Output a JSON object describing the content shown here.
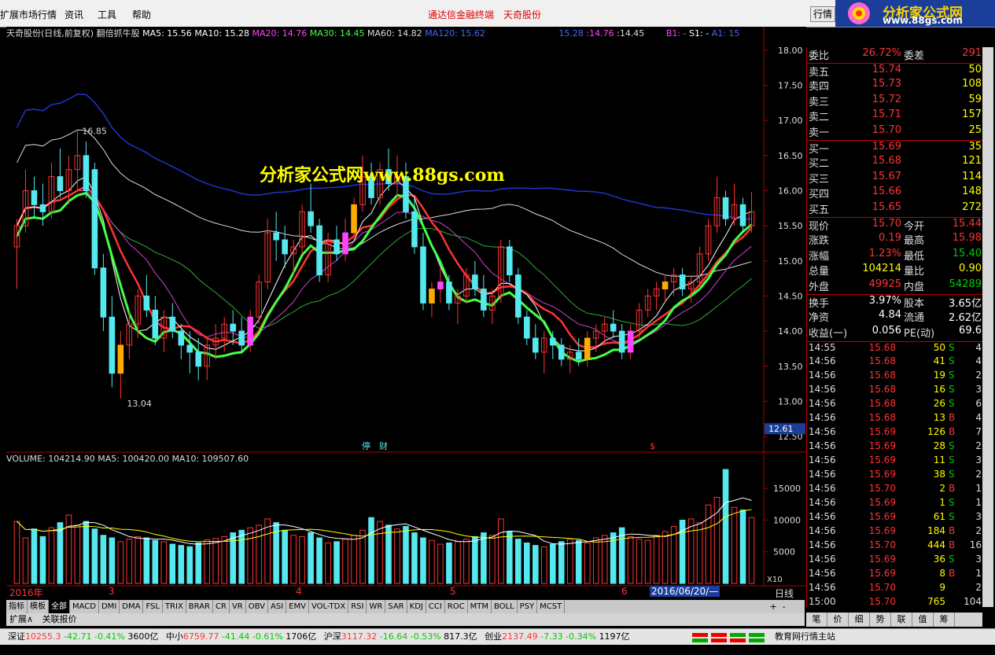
{
  "menu": {
    "title": "扩展市场行情",
    "items": [
      "资讯",
      "工具",
      "帮助"
    ],
    "center_a": "通达信金融终端",
    "center_b": "天奇股份",
    "row_btn": "行情"
  },
  "logo": {
    "title": "分析家公式网",
    "url": "www.88gs.com"
  },
  "chart_header": {
    "name": "天奇股份(日线,前复权)",
    "formula": "翻倍抓牛股",
    "ma5": "MA5: 15.56",
    "ma10": "MA10: 15.28",
    "ma20": "MA20: 14.76",
    "ma30": "MA30: 14.45",
    "ma60": "MA60: 14.82",
    "ma120": "MA120: 15.62",
    "extra1": "15.28",
    "extra2": ":14.76",
    "extra3": ":14.45",
    "b1": "B1: -",
    "s1": "S1: -",
    "a1": "A1: 15"
  },
  "watermark": "分析家公式网www.88gs.com",
  "chart_data": {
    "type": "candlestick",
    "ylim": [
      12.4,
      18.2
    ],
    "yticks": [
      "18.00",
      "17.50",
      "17.00",
      "16.50",
      "16.00",
      "15.50",
      "15.00",
      "14.50",
      "14.00",
      "13.50",
      "13.00",
      "12.50"
    ],
    "current_price_label": "12.61",
    "high_label": "16.85",
    "low_label": "13.04",
    "event_labels": [
      "停",
      "财",
      "$"
    ],
    "volume_header": "VOLUME: 104214.90  MA5: 100420.00  MA10: 109507.60",
    "volume_ticks": [
      "15000",
      "10000",
      "5000"
    ],
    "volume_unit": "X10",
    "date_labels": [
      "2016年",
      "3",
      "4",
      "5",
      "6"
    ],
    "cursor_date": "2016/06/20/—",
    "ohlc": [
      [
        15.2,
        15.6,
        14.6,
        15.5
      ],
      [
        15.5,
        16.3,
        15.4,
        16.0
      ],
      [
        16.0,
        16.2,
        15.6,
        15.8
      ],
      [
        15.8,
        16.1,
        15.5,
        15.7
      ],
      [
        15.7,
        16.4,
        15.6,
        16.2
      ],
      [
        16.2,
        16.6,
        15.9,
        16.0
      ],
      [
        16.0,
        16.5,
        15.8,
        16.3
      ],
      [
        16.3,
        16.85,
        16.0,
        16.5
      ],
      [
        16.5,
        16.7,
        15.9,
        16.0
      ],
      [
        16.3,
        16.4,
        14.8,
        14.9
      ],
      [
        14.9,
        15.1,
        14.0,
        14.2
      ],
      [
        14.2,
        14.5,
        13.2,
        13.4
      ],
      [
        13.4,
        14.0,
        13.04,
        13.8
      ],
      [
        13.8,
        14.3,
        13.6,
        14.1
      ],
      [
        14.1,
        14.6,
        13.9,
        14.5
      ],
      [
        14.5,
        14.8,
        14.2,
        14.3
      ],
      [
        14.3,
        14.5,
        13.8,
        13.9
      ],
      [
        13.9,
        14.3,
        13.7,
        14.2
      ],
      [
        14.2,
        14.4,
        13.9,
        14.0
      ],
      [
        14.0,
        14.1,
        13.6,
        13.8
      ],
      [
        13.8,
        14.0,
        13.4,
        13.7
      ],
      [
        13.7,
        13.9,
        13.3,
        13.5
      ],
      [
        13.5,
        13.9,
        13.3,
        13.8
      ],
      [
        13.8,
        14.1,
        13.6,
        13.9
      ],
      [
        13.9,
        14.2,
        13.7,
        14.1
      ],
      [
        14.1,
        14.3,
        13.8,
        14.0
      ],
      [
        14.0,
        14.2,
        13.7,
        13.8
      ],
      [
        13.8,
        14.3,
        13.7,
        14.2
      ],
      [
        14.2,
        14.8,
        14.1,
        14.7
      ],
      [
        14.7,
        15.6,
        14.6,
        15.4
      ],
      [
        15.4,
        15.7,
        15.0,
        15.3
      ],
      [
        15.3,
        15.5,
        14.9,
        15.1
      ],
      [
        15.1,
        15.3,
        14.8,
        15.2
      ],
      [
        15.2,
        15.8,
        15.1,
        15.7
      ],
      [
        15.7,
        16.1,
        15.4,
        15.5
      ],
      [
        15.5,
        15.6,
        14.7,
        14.8
      ],
      [
        14.8,
        15.4,
        14.7,
        15.3
      ],
      [
        15.3,
        15.5,
        15.0,
        15.1
      ],
      [
        15.1,
        15.6,
        15.0,
        15.4
      ],
      [
        15.4,
        15.9,
        15.3,
        15.8
      ],
      [
        15.8,
        16.5,
        15.7,
        16.2
      ],
      [
        16.2,
        16.4,
        15.8,
        15.9
      ],
      [
        15.9,
        16.4,
        15.8,
        16.3
      ],
      [
        16.3,
        16.6,
        16.0,
        16.1
      ],
      [
        16.1,
        16.5,
        15.9,
        16.2
      ],
      [
        16.2,
        16.4,
        15.6,
        15.7
      ],
      [
        15.7,
        15.9,
        15.1,
        15.2
      ],
      [
        15.2,
        15.4,
        14.3,
        14.4
      ],
      [
        14.4,
        14.7,
        14.2,
        14.6
      ],
      [
        14.6,
        14.9,
        14.4,
        14.7
      ],
      [
        14.7,
        14.8,
        14.3,
        14.4
      ],
      [
        14.4,
        14.6,
        14.1,
        14.5
      ],
      [
        14.5,
        14.9,
        14.4,
        14.8
      ],
      [
        14.8,
        15.0,
        14.5,
        14.6
      ],
      [
        14.6,
        14.8,
        14.2,
        14.3
      ],
      [
        14.3,
        14.6,
        14.1,
        14.5
      ],
      [
        14.5,
        15.3,
        14.4,
        15.2
      ],
      [
        15.2,
        15.3,
        14.7,
        14.8
      ],
      [
        14.8,
        14.9,
        14.1,
        14.2
      ],
      [
        14.2,
        14.3,
        13.8,
        13.9
      ],
      [
        13.9,
        14.1,
        13.6,
        13.7
      ],
      [
        13.7,
        14.0,
        13.4,
        13.9
      ],
      [
        13.9,
        14.0,
        13.6,
        13.8
      ],
      [
        13.8,
        13.9,
        13.5,
        13.6
      ],
      [
        13.6,
        13.8,
        13.4,
        13.7
      ],
      [
        13.7,
        13.9,
        13.5,
        13.6
      ],
      [
        13.6,
        14.0,
        13.5,
        13.9
      ],
      [
        13.9,
        14.1,
        13.7,
        14.0
      ],
      [
        14.0,
        14.2,
        13.8,
        14.1
      ],
      [
        14.1,
        14.3,
        13.9,
        14.0
      ],
      [
        14.0,
        14.1,
        13.6,
        13.7
      ],
      [
        13.7,
        14.1,
        13.6,
        14.0
      ],
      [
        14.0,
        14.4,
        13.9,
        14.3
      ],
      [
        14.3,
        14.6,
        14.2,
        14.5
      ],
      [
        14.5,
        14.7,
        14.3,
        14.6
      ],
      [
        14.6,
        14.8,
        14.4,
        14.7
      ],
      [
        14.7,
        14.9,
        14.5,
        14.8
      ],
      [
        14.8,
        14.9,
        14.5,
        14.6
      ],
      [
        14.6,
        14.8,
        14.4,
        14.7
      ],
      [
        14.7,
        15.2,
        14.6,
        15.1
      ],
      [
        15.1,
        15.6,
        15.0,
        15.5
      ],
      [
        15.5,
        16.2,
        15.4,
        15.9
      ],
      [
        15.9,
        16.0,
        15.5,
        15.6
      ],
      [
        15.6,
        16.1,
        15.5,
        15.8
      ],
      [
        15.8,
        15.9,
        15.4,
        15.5
      ],
      [
        15.5,
        15.98,
        15.4,
        15.7
      ]
    ],
    "volume": [
      9800,
      7200,
      8600,
      7400,
      8800,
      9600,
      10800,
      9200,
      9800,
      8600,
      7600,
      7200,
      6600,
      7000,
      7400,
      7200,
      6800,
      6600,
      6200,
      6000,
      5800,
      6400,
      6900,
      7100,
      7400,
      8000,
      8400,
      8800,
      9200,
      10200,
      9600,
      8400,
      7600,
      7400,
      8000,
      7200,
      6400,
      6600,
      7000,
      7600,
      8400,
      10400,
      9800,
      9200,
      8600,
      9000,
      8000,
      7200,
      6800,
      6200,
      6400,
      6600,
      7000,
      7400,
      8000,
      7600,
      10200,
      8200,
      7000,
      6400,
      6000,
      5800,
      6200,
      6600,
      7000,
      6800,
      6400,
      7200,
      7600,
      8000,
      8800,
      7400,
      7000,
      6800,
      7600,
      8200,
      9000,
      10000,
      10200,
      9600,
      12400,
      13600,
      18000,
      12000,
      11600,
      10400
    ]
  },
  "quote": {
    "rows": [
      {
        "l": "委比",
        "v": "26.72%",
        "l2": "委差",
        "v2": "291",
        "c": "up",
        "c2": "up"
      },
      {
        "l": "卖五",
        "v": "15.74",
        "l2": "",
        "v2": "50",
        "c": "up",
        "c2": "yl"
      },
      {
        "l": "卖四",
        "v": "15.73",
        "l2": "",
        "v2": "108",
        "c": "up",
        "c2": "yl"
      },
      {
        "l": "卖三",
        "v": "15.72",
        "l2": "",
        "v2": "59",
        "c": "up",
        "c2": "yl"
      },
      {
        "l": "卖二",
        "v": "15.71",
        "l2": "",
        "v2": "157",
        "c": "up",
        "c2": "yl"
      },
      {
        "l": "卖一",
        "v": "15.70",
        "l2": "",
        "v2": "25",
        "c": "up",
        "c2": "yl"
      },
      {
        "l": "买一",
        "v": "15.69",
        "l2": "",
        "v2": "35",
        "c": "up",
        "c2": "yl"
      },
      {
        "l": "买二",
        "v": "15.68",
        "l2": "",
        "v2": "121",
        "c": "up",
        "c2": "yl"
      },
      {
        "l": "买三",
        "v": "15.67",
        "l2": "",
        "v2": "114",
        "c": "up",
        "c2": "yl"
      },
      {
        "l": "买四",
        "v": "15.66",
        "l2": "",
        "v2": "148",
        "c": "up",
        "c2": "yl"
      },
      {
        "l": "买五",
        "v": "15.65",
        "l2": "",
        "v2": "272",
        "c": "up",
        "c2": "yl"
      },
      {
        "l": "现价",
        "v": "15.70",
        "l2": "今开",
        "v2": "15.44",
        "c": "up",
        "c2": "up"
      },
      {
        "l": "涨跌",
        "v": "0.19",
        "l2": "最高",
        "v2": "15.98",
        "c": "up",
        "c2": "up"
      },
      {
        "l": "涨幅",
        "v": "1.23%",
        "l2": "最低",
        "v2": "15.40",
        "c": "up",
        "c2": "dn"
      },
      {
        "l": "总量",
        "v": "104214",
        "l2": "量比",
        "v2": "0.90",
        "c": "yl",
        "c2": "yl"
      },
      {
        "l": "外盘",
        "v": "49925",
        "l2": "内盘",
        "v2": "54289",
        "c": "up",
        "c2": "dn"
      },
      {
        "l": "换手",
        "v": "3.97%",
        "l2": "股本",
        "v2": "3.65亿",
        "c": "wh",
        "c2": "wh"
      },
      {
        "l": "净资",
        "v": "4.84",
        "l2": "流通",
        "v2": "2.62亿",
        "c": "wh",
        "c2": "wh"
      },
      {
        "l": "收益(一)",
        "v": "0.056",
        "l2": "PE(动)",
        "v2": "69.6",
        "c": "wh",
        "c2": "wh"
      }
    ],
    "trades": [
      {
        "t": "14:55",
        "p": "15.68",
        "v": "50",
        "b": "S",
        "n": "4"
      },
      {
        "t": "14:56",
        "p": "15.68",
        "v": "41",
        "b": "S",
        "n": "4"
      },
      {
        "t": "14:56",
        "p": "15.68",
        "v": "19",
        "b": "S",
        "n": "2"
      },
      {
        "t": "14:56",
        "p": "15.68",
        "v": "16",
        "b": "S",
        "n": "3"
      },
      {
        "t": "14:56",
        "p": "15.68",
        "v": "26",
        "b": "S",
        "n": "6"
      },
      {
        "t": "14:56",
        "p": "15.68",
        "v": "13",
        "b": "B",
        "n": "4"
      },
      {
        "t": "14:56",
        "p": "15.69",
        "v": "126",
        "b": "B",
        "n": "7"
      },
      {
        "t": "14:56",
        "p": "15.69",
        "v": "28",
        "b": "S",
        "n": "2"
      },
      {
        "t": "14:56",
        "p": "15.69",
        "v": "11",
        "b": "S",
        "n": "3"
      },
      {
        "t": "14:56",
        "p": "15.69",
        "v": "38",
        "b": "S",
        "n": "2"
      },
      {
        "t": "14:56",
        "p": "15.70",
        "v": "2",
        "b": "B",
        "n": "1"
      },
      {
        "t": "14:56",
        "p": "15.69",
        "v": "1",
        "b": "S",
        "n": "1"
      },
      {
        "t": "14:56",
        "p": "15.69",
        "v": "61",
        "b": "S",
        "n": "3"
      },
      {
        "t": "14:56",
        "p": "15.69",
        "v": "184",
        "b": "B",
        "n": "2"
      },
      {
        "t": "14:56",
        "p": "15.70",
        "v": "444",
        "b": "B",
        "n": "16"
      },
      {
        "t": "14:56",
        "p": "15.69",
        "v": "36",
        "b": "S",
        "n": "3"
      },
      {
        "t": "14:56",
        "p": "15.69",
        "v": "8",
        "b": "B",
        "n": "1"
      },
      {
        "t": "14:56",
        "p": "15.70",
        "v": "9",
        "b": "",
        "n": "2"
      },
      {
        "t": "15:00",
        "p": "15.70",
        "v": "765",
        "b": "",
        "n": "104"
      }
    ],
    "buttons": [
      "笔",
      "价",
      "细",
      "势",
      "联",
      "值",
      "筹"
    ]
  },
  "daybtn": "日线",
  "tabs": [
    "指标",
    "模板",
    "全部",
    "MACD",
    "DMI",
    "DMA",
    "FSL",
    "TRIX",
    "BRAR",
    "CR",
    "VR",
    "OBV",
    "ASI",
    "EMV",
    "VOL-TDX",
    "RSI",
    "WR",
    "SAR",
    "KDJ",
    "CCI",
    "ROC",
    "MTM",
    "BOLL",
    "PSY",
    "MCST"
  ],
  "ext_tabs": [
    "扩展∧",
    "关联报价"
  ],
  "status": {
    "sz_label": "深证",
    "sz_val": "10255.3",
    "sz_chg": "-42.71",
    "sz_pct": "-0.41%",
    "sz_amt": "3600亿",
    "zx_label": "中小",
    "zx_val": "6759.77",
    "zx_chg": "-41.44",
    "zx_pct": "-0.61%",
    "zx_amt": "1706亿",
    "hs_label": "沪深",
    "hs_val": "3117.32",
    "hs_chg": "-16.64",
    "hs_pct": "-0.53%",
    "hs_amt": "817.3亿",
    "cy_label": "创业",
    "cy_val": "2137.49",
    "cy_chg": "-7.33",
    "cy_pct": "-0.34%",
    "cy_amt": "1197亿",
    "site": "教育网行情主站"
  }
}
